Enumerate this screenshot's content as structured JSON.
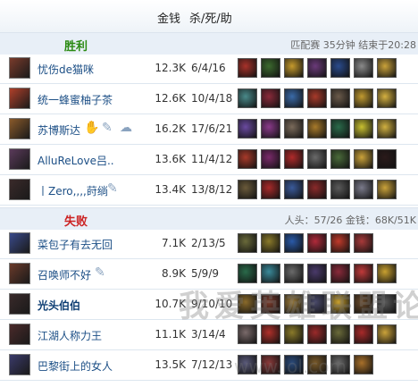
{
  "header": {
    "gold_label": "金钱",
    "kda_label": "杀/死/助"
  },
  "win": {
    "label": "胜利",
    "info": "匹配赛 35分钟 结束于20:28"
  },
  "lose": {
    "label": "失败",
    "info": "人头：57/26 金钱：68K/51K"
  },
  "win_players": [
    {
      "name": "忧伤de猫咪",
      "gold": "12.3K",
      "kda": "6/4/16",
      "avatar": "#7a3b2b",
      "items": [
        "#a8322a",
        "#3c6a2e",
        "#c59a2c",
        "#6b3a7a",
        "#2a4b8c",
        "#8a8a8a",
        "#caa23a"
      ]
    },
    {
      "name": "统一蜂蜜柚子茶",
      "gold": "12.6K",
      "kda": "10/4/18",
      "avatar": "#b0402a",
      "items": [
        "#4a8a8a",
        "#8a2a3a",
        "#3a6aa8",
        "#a83a2a",
        "#6a5a4a",
        "#c09a30",
        "#d4b040"
      ]
    },
    {
      "name": "苏博斯达",
      "gold": "16.2K",
      "kda": "17/6/21",
      "avatar": "#8a5a2a",
      "items": [
        "#6a4aa0",
        "#8a3a8a",
        "#7a6a5a",
        "#a87a2a",
        "#2a6a4a",
        "#c8c030",
        "#d0b040"
      ]
    },
    {
      "name": "AlluReLove吕..",
      "gold": "13.6K",
      "kda": "11/4/12",
      "avatar": "#5a3a5a",
      "items": [
        "#a83a2a",
        "#7a2a6a",
        "#b02a2a",
        "#6a6a6a",
        "#4a6a3a",
        "#caa23a",
        "#2a1a1a"
      ]
    },
    {
      "name": "丨Zero,,,,莳绱",
      "gold": "13.4K",
      "kda": "13/8/12",
      "avatar": "#3a2a2a",
      "items": [
        "#6a5a3a",
        "#a82a2a",
        "#3a5a9a",
        "#8a2a2a",
        "#5a5a5a",
        "#7a7a8a",
        "#caa23a"
      ]
    }
  ],
  "lose_players": [
    {
      "name": "菜包子有去无回",
      "gold": "7.1K",
      "kda": "2/13/5",
      "avatar": "#3a4a8a",
      "items": [
        "#6a6a3a",
        "#8a7a2a",
        "#2a5aa8",
        "#b02a3a",
        "#c03a2a",
        "#a83a3a",
        "#ffffff"
      ]
    },
    {
      "name": "召唤师不好",
      "gold": "8.9K",
      "kda": "5/9/9",
      "avatar": "#6a3a2a",
      "items": [
        "#2a6a4a",
        "#3a8a9a",
        "#6a6a6a",
        "#4a3a6a",
        "#8a2a3a",
        "#c03a3a",
        "#c8a030"
      ]
    },
    {
      "name": "光头伯伯",
      "gold": "10.7K",
      "kda": "9/10/10",
      "avatar": "#3a2a2a",
      "items": [
        "#8a6a2a",
        "#7a3a2a",
        "#9a7a3a",
        "#4a4a6a",
        "#c8a030",
        "#6a4a2a",
        "#5a5a5a"
      ]
    },
    {
      "name": "江湖人称力王",
      "gold": "11.1K",
      "kda": "3/14/4",
      "avatar": "#4a2a2a",
      "items": [
        "#7a6a6a",
        "#b0302a",
        "#8a7a2a",
        "#9a2a2a",
        "#6a6a3a",
        "#a82a2a",
        "#caa23a"
      ]
    },
    {
      "name": "巴黎街上的女人",
      "gold": "13.5K",
      "kda": "7/12/13",
      "avatar": "#3a3a6a",
      "items": [
        "#5a5a7a",
        "#8a3a3a",
        "#2a4a7a",
        "#7a5a2a",
        "#6a6a6a",
        "#a8702a",
        "#ffffff"
      ]
    }
  ],
  "watermark": {
    "line1": "我爱英雄联盟论坛",
    "line2": "www.lol.com"
  }
}
